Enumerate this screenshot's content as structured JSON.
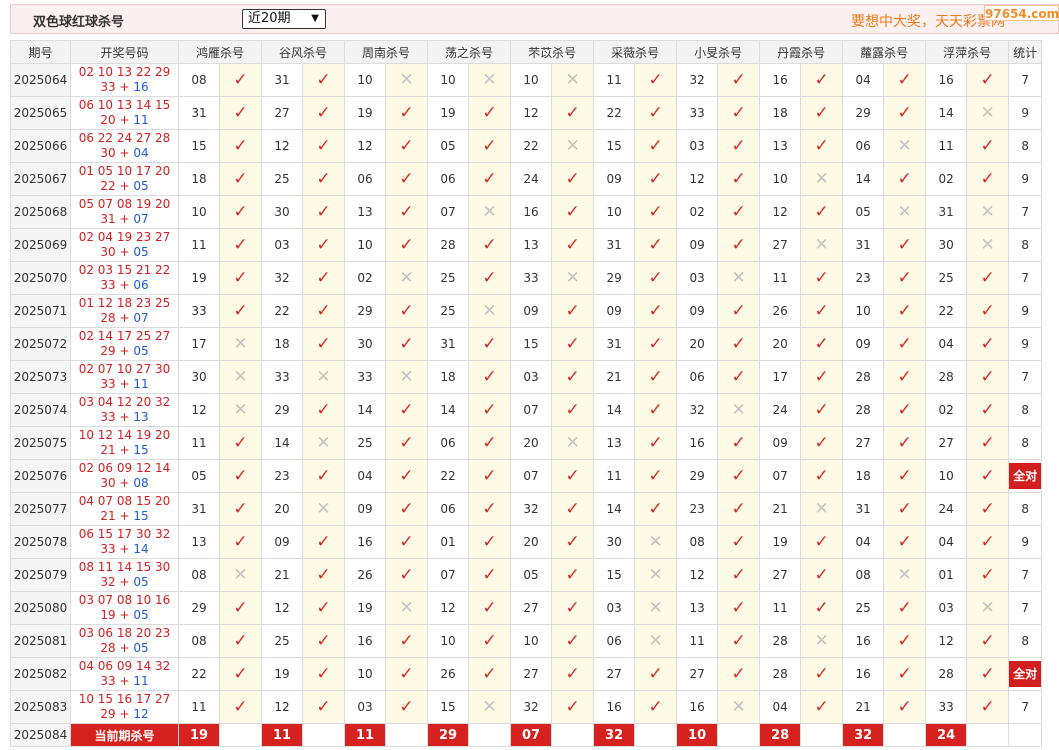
{
  "header": {
    "title": "双色球红球杀号",
    "range_select": "近20期",
    "slogan": "要想中大奖，天天彩票网",
    "watermark": "97654.com"
  },
  "columns": {
    "issue": "期号",
    "draw": "开奖号码",
    "experts": [
      "鸿雁杀号",
      "谷风杀号",
      "周南杀号",
      "荡之杀号",
      "芣苡杀号",
      "采薇杀号",
      "小旻杀号",
      "丹霞杀号",
      "蘿露杀号",
      "浮萍杀号"
    ],
    "count": "统计"
  },
  "rows": [
    {
      "issue": "2025064",
      "reds": "02 10 13 22 29",
      "tail": "33",
      "blue": "16",
      "kills": [
        "08",
        "31",
        "10",
        "10",
        "10",
        "11",
        "32",
        "16",
        "04",
        "16"
      ],
      "hits": [
        1,
        1,
        0,
        0,
        0,
        1,
        1,
        1,
        1,
        1
      ],
      "count": "7"
    },
    {
      "issue": "2025065",
      "reds": "06 10 13 14 15",
      "tail": "20",
      "blue": "11",
      "kills": [
        "31",
        "27",
        "19",
        "19",
        "12",
        "22",
        "33",
        "18",
        "29",
        "14"
      ],
      "hits": [
        1,
        1,
        1,
        1,
        1,
        1,
        1,
        1,
        1,
        0
      ],
      "count": "9"
    },
    {
      "issue": "2025066",
      "reds": "06 22 24 27 28",
      "tail": "30",
      "blue": "04",
      "kills": [
        "15",
        "12",
        "12",
        "05",
        "22",
        "15",
        "03",
        "13",
        "06",
        "11"
      ],
      "hits": [
        1,
        1,
        1,
        1,
        0,
        1,
        1,
        1,
        0,
        1
      ],
      "count": "8"
    },
    {
      "issue": "2025067",
      "reds": "01 05 10 17 20",
      "tail": "22",
      "blue": "05",
      "kills": [
        "18",
        "25",
        "06",
        "06",
        "24",
        "09",
        "12",
        "10",
        "14",
        "02"
      ],
      "hits": [
        1,
        1,
        1,
        1,
        1,
        1,
        1,
        0,
        1,
        1
      ],
      "count": "9"
    },
    {
      "issue": "2025068",
      "reds": "05 07 08 19 20",
      "tail": "31",
      "blue": "07",
      "kills": [
        "10",
        "30",
        "13",
        "07",
        "16",
        "10",
        "02",
        "12",
        "05",
        "31"
      ],
      "hits": [
        1,
        1,
        1,
        0,
        1,
        1,
        1,
        1,
        0,
        0
      ],
      "count": "7"
    },
    {
      "issue": "2025069",
      "reds": "02 04 19 23 27",
      "tail": "30",
      "blue": "05",
      "kills": [
        "11",
        "03",
        "10",
        "28",
        "13",
        "31",
        "09",
        "27",
        "31",
        "30"
      ],
      "hits": [
        1,
        1,
        1,
        1,
        1,
        1,
        1,
        0,
        1,
        0
      ],
      "count": "8"
    },
    {
      "issue": "2025070",
      "reds": "02 03 15 21 22",
      "tail": "33",
      "blue": "06",
      "kills": [
        "19",
        "32",
        "02",
        "25",
        "33",
        "29",
        "03",
        "11",
        "23",
        "25"
      ],
      "hits": [
        1,
        1,
        0,
        1,
        0,
        1,
        0,
        1,
        1,
        1
      ],
      "count": "7"
    },
    {
      "issue": "2025071",
      "reds": "01 12 18 23 25",
      "tail": "28",
      "blue": "07",
      "kills": [
        "33",
        "22",
        "29",
        "25",
        "09",
        "09",
        "09",
        "26",
        "10",
        "22"
      ],
      "hits": [
        1,
        1,
        1,
        0,
        1,
        1,
        1,
        1,
        1,
        1
      ],
      "count": "9"
    },
    {
      "issue": "2025072",
      "reds": "02 14 17 25 27",
      "tail": "29",
      "blue": "05",
      "kills": [
        "17",
        "18",
        "30",
        "31",
        "15",
        "31",
        "20",
        "20",
        "09",
        "04"
      ],
      "hits": [
        0,
        1,
        1,
        1,
        1,
        1,
        1,
        1,
        1,
        1
      ],
      "count": "9"
    },
    {
      "issue": "2025073",
      "reds": "02 07 10 27 30",
      "tail": "33",
      "blue": "11",
      "kills": [
        "30",
        "33",
        "33",
        "18",
        "03",
        "21",
        "06",
        "17",
        "28",
        "28"
      ],
      "hits": [
        0,
        0,
        0,
        1,
        1,
        1,
        1,
        1,
        1,
        1
      ],
      "count": "7"
    },
    {
      "issue": "2025074",
      "reds": "03 04 12 20 32",
      "tail": "33",
      "blue": "13",
      "kills": [
        "12",
        "29",
        "14",
        "14",
        "07",
        "14",
        "32",
        "24",
        "28",
        "02"
      ],
      "hits": [
        0,
        1,
        1,
        1,
        1,
        1,
        0,
        1,
        1,
        1
      ],
      "count": "8"
    },
    {
      "issue": "2025075",
      "reds": "10 12 14 19 20",
      "tail": "21",
      "blue": "15",
      "kills": [
        "11",
        "14",
        "25",
        "06",
        "20",
        "13",
        "16",
        "09",
        "27",
        "27"
      ],
      "hits": [
        1,
        0,
        1,
        1,
        0,
        1,
        1,
        1,
        1,
        1
      ],
      "count": "8"
    },
    {
      "issue": "2025076",
      "reds": "02 06 09 12 14",
      "tail": "30",
      "blue": "08",
      "kills": [
        "05",
        "23",
        "04",
        "22",
        "07",
        "11",
        "29",
        "07",
        "18",
        "10"
      ],
      "hits": [
        1,
        1,
        1,
        1,
        1,
        1,
        1,
        1,
        1,
        1
      ],
      "count": "全对"
    },
    {
      "issue": "2025077",
      "reds": "04 07 08 15 20",
      "tail": "21",
      "blue": "15",
      "kills": [
        "31",
        "20",
        "09",
        "06",
        "32",
        "14",
        "23",
        "21",
        "31",
        "24"
      ],
      "hits": [
        1,
        0,
        1,
        1,
        1,
        1,
        1,
        0,
        1,
        1
      ],
      "count": "8"
    },
    {
      "issue": "2025078",
      "reds": "06 15 17 30 32",
      "tail": "33",
      "blue": "14",
      "kills": [
        "13",
        "09",
        "16",
        "01",
        "20",
        "30",
        "08",
        "19",
        "04",
        "04"
      ],
      "hits": [
        1,
        1,
        1,
        1,
        1,
        0,
        1,
        1,
        1,
        1
      ],
      "count": "9"
    },
    {
      "issue": "2025079",
      "reds": "08 11 14 15 30",
      "tail": "32",
      "blue": "05",
      "kills": [
        "08",
        "21",
        "26",
        "07",
        "05",
        "15",
        "12",
        "27",
        "08",
        "01"
      ],
      "hits": [
        0,
        1,
        1,
        1,
        1,
        0,
        1,
        1,
        0,
        1
      ],
      "count": "7"
    },
    {
      "issue": "2025080",
      "reds": "03 07 08 10 16",
      "tail": "19",
      "blue": "05",
      "kills": [
        "29",
        "12",
        "19",
        "12",
        "27",
        "03",
        "13",
        "11",
        "25",
        "03"
      ],
      "hits": [
        1,
        1,
        0,
        1,
        1,
        0,
        1,
        1,
        1,
        0
      ],
      "count": "7"
    },
    {
      "issue": "2025081",
      "reds": "03 06 18 20 23",
      "tail": "28",
      "blue": "05",
      "kills": [
        "08",
        "25",
        "16",
        "10",
        "10",
        "06",
        "11",
        "28",
        "16",
        "12"
      ],
      "hits": [
        1,
        1,
        1,
        1,
        1,
        0,
        1,
        0,
        1,
        1
      ],
      "count": "8"
    },
    {
      "issue": "2025082",
      "reds": "04 06 09 14 32",
      "tail": "33",
      "blue": "11",
      "kills": [
        "22",
        "19",
        "10",
        "26",
        "27",
        "27",
        "27",
        "28",
        "16",
        "28"
      ],
      "hits": [
        1,
        1,
        1,
        1,
        1,
        1,
        1,
        1,
        1,
        1
      ],
      "count": "全对"
    },
    {
      "issue": "2025083",
      "reds": "10 15 16 17 27",
      "tail": "29",
      "blue": "12",
      "kills": [
        "11",
        "12",
        "03",
        "15",
        "32",
        "16",
        "16",
        "04",
        "21",
        "33"
      ],
      "hits": [
        1,
        1,
        1,
        0,
        1,
        1,
        0,
        1,
        1,
        1
      ],
      "count": "7"
    }
  ],
  "current": {
    "issue": "2025084",
    "label": "当前期杀号",
    "kills": [
      "19",
      "11",
      "11",
      "29",
      "07",
      "32",
      "10",
      "28",
      "32",
      "24"
    ]
  },
  "icons": {
    "hit": "check-icon",
    "miss": "cross-icon"
  },
  "colors": {
    "accent_red": "#d6221f",
    "blue_ball": "#1d5bd6",
    "hit_mark": "#d42a2a",
    "miss_mark": "#c4c4c4",
    "mark_bg": "#fdfbe6",
    "slogan": "#ec7b1c"
  }
}
